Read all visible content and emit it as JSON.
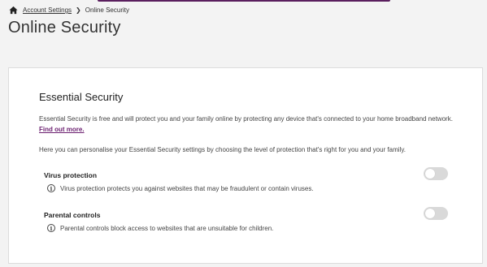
{
  "breadcrumb": {
    "home_icon": "home-icon",
    "items": [
      {
        "label": "Account Settings"
      },
      {
        "label": "Online Security"
      }
    ]
  },
  "page": {
    "title": "Online Security"
  },
  "card": {
    "title": "Essential Security",
    "intro": "Essential Security is free and will protect you and your family online by protecting any device that's connected to your home broadband network.",
    "intro_link": "Find out more.",
    "intro2": "Here you can personalise your Essential Security settings by choosing the level of protection that's right for you and your family.",
    "settings": [
      {
        "label": "Virus protection",
        "help": "Virus protection protects you against websites that may be fraudulent or contain viruses.",
        "enabled": false
      },
      {
        "label": "Parental controls",
        "help": "Parental controls block access to websites that are unsuitable for children.",
        "enabled": false
      }
    ]
  },
  "colors": {
    "accent": "#6b1f70",
    "toggle_off": "#d9d9d9"
  }
}
